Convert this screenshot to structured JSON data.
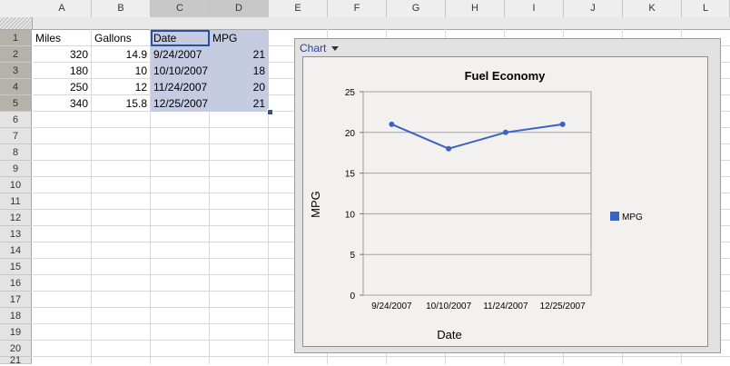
{
  "columns": [
    "A",
    "B",
    "C",
    "D",
    "E",
    "F",
    "G",
    "H",
    "I",
    "J",
    "K",
    "L"
  ],
  "rows": [
    "1",
    "2",
    "3",
    "4",
    "5",
    "6",
    "7",
    "8",
    "9",
    "10",
    "11",
    "12",
    "13",
    "14",
    "15",
    "16",
    "17",
    "18",
    "19",
    "20",
    "21"
  ],
  "cells": [
    [
      "Miles",
      "Gallons",
      "Date",
      "MPG"
    ],
    [
      "320",
      "14.9",
      "9/24/2007",
      "21"
    ],
    [
      "180",
      "10",
      "10/10/2007",
      "18"
    ],
    [
      "250",
      "12",
      "11/24/2007",
      "20"
    ],
    [
      "340",
      "15.8",
      "12/25/2007",
      "21"
    ]
  ],
  "chart_menu": {
    "label": "Chart",
    "icon": "dropdown-arrow-icon"
  },
  "colors": {
    "selection": "#c5cbe0",
    "accent": "#2a50a0",
    "series": "#3a64c4"
  },
  "chart_data": {
    "type": "line",
    "title": "Fuel Economy",
    "xlabel": "Date",
    "ylabel": "MPG",
    "categories": [
      "9/24/2007",
      "10/10/2007",
      "11/24/2007",
      "12/25/2007"
    ],
    "series": [
      {
        "name": "MPG",
        "values": [
          21,
          18,
          20,
          21
        ]
      }
    ],
    "ylim": [
      0,
      25
    ],
    "yticks": [
      "0",
      "5",
      "10",
      "15",
      "20",
      "25"
    ],
    "grid": true,
    "legend": "right"
  }
}
